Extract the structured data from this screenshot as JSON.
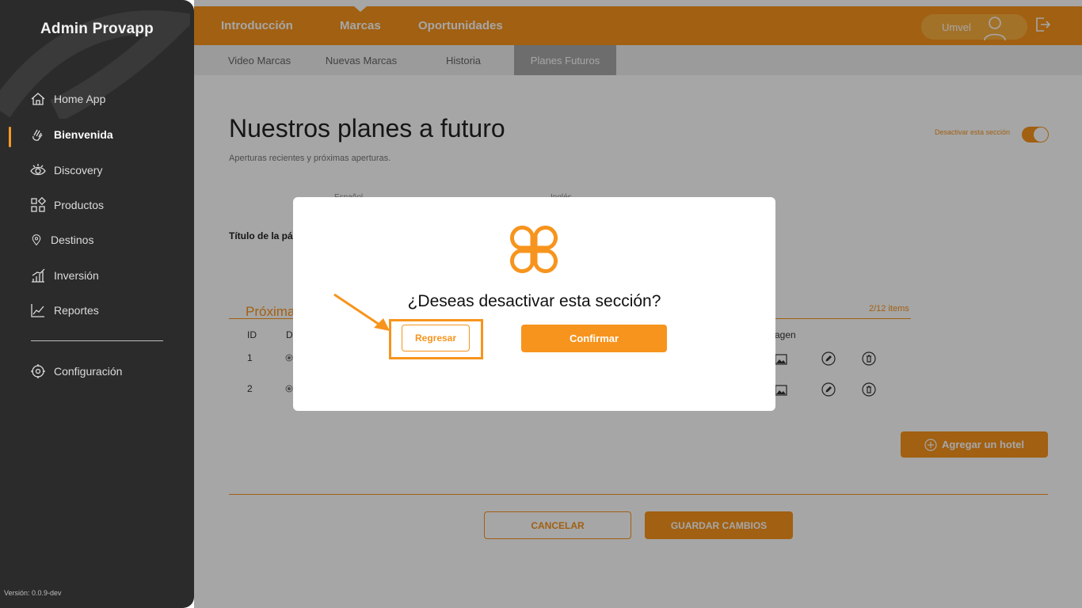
{
  "sidebar": {
    "brand": "Admin Provapp",
    "items": [
      {
        "label": "Home App",
        "icon": "home-icon"
      },
      {
        "label": "Bienvenida",
        "icon": "waving-hand-icon"
      },
      {
        "label": "Discovery",
        "icon": "eye-icon"
      },
      {
        "label": "Productos",
        "icon": "grid-icon"
      },
      {
        "label": "Destinos",
        "icon": "map-pin-icon"
      },
      {
        "label": "Inversión",
        "icon": "bar-chart-icon"
      },
      {
        "label": "Reportes",
        "icon": "line-chart-icon"
      }
    ],
    "settings_label": "Configuración",
    "version": "Versión: 0.0.9-dev"
  },
  "topbar": {
    "tabs": [
      "Introducción",
      "Marcas",
      "Oportunidades"
    ],
    "active_tab": "Marcas",
    "user_name": "Umvel"
  },
  "subnav": {
    "tabs": [
      "Video Marcas",
      "Nuevas Marcas",
      "Historia",
      "Planes Futuros"
    ],
    "active_tab": "Planes Futuros"
  },
  "page": {
    "title": "Nuestros planes a futuro",
    "subtitle": "Aperturas recientes y próximas aperturas.",
    "toggle_label": "Desactivar esta sección",
    "lang_es": "Español",
    "lang_en": "Inglés",
    "field_label": "Título de la pá",
    "section_title": "Próxima",
    "items_count": "2/12 items",
    "columns": [
      "ID",
      "D",
      "agen"
    ],
    "rows": [
      {
        "id": "1"
      },
      {
        "id": "2"
      }
    ],
    "add_button": "Agregar un hotel",
    "cancel_button": "CANCELAR",
    "save_button": "GUARDAR CAMBIOS"
  },
  "modal": {
    "question": "¿Deseas desactivar esta sección?",
    "back_button": "Regresar",
    "confirm_button": "Confirmar"
  },
  "colors": {
    "accent": "#f7941d",
    "sidebar_bg": "#2b2b2b"
  }
}
